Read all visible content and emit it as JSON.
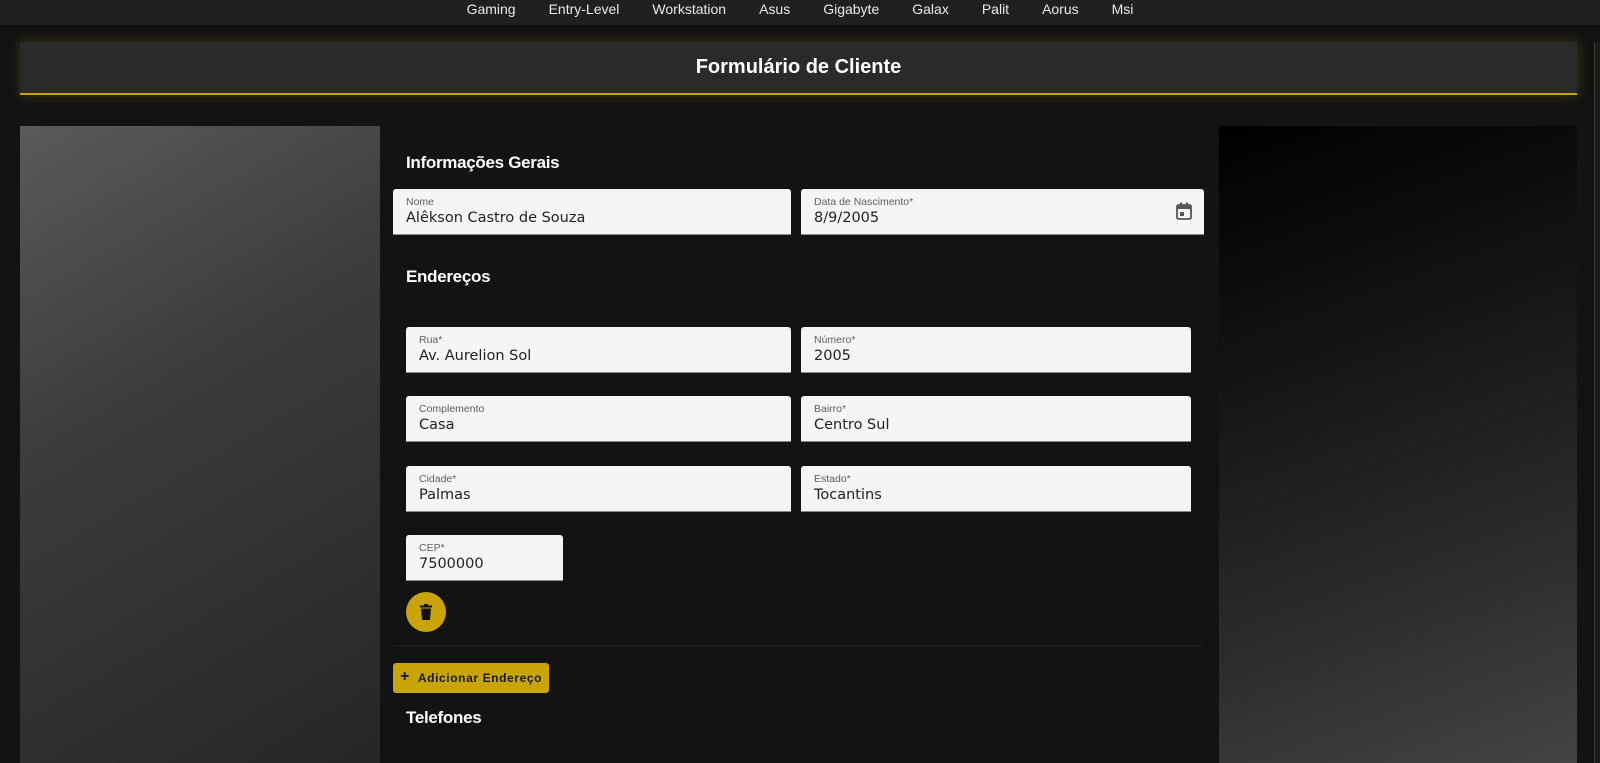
{
  "topnav": {
    "items": [
      "Gaming",
      "Entry-Level",
      "Workstation",
      "Asus",
      "Gigabyte",
      "Galax",
      "Palit",
      "Aorus",
      "Msi"
    ]
  },
  "header": {
    "title": "Formulário de Cliente"
  },
  "sections": {
    "general": "Informações Gerais",
    "addresses": "Endereços",
    "phones": "Telefones"
  },
  "general": {
    "name": {
      "label": "Nome",
      "value": "Alêkson Castro de Souza"
    },
    "birthdate": {
      "label": "Data de Nascimento*",
      "value": "8/9/2005",
      "icon": "calendar-icon"
    }
  },
  "address": {
    "street": {
      "label": "Rua*",
      "value": "Av. Aurelion Sol"
    },
    "number": {
      "label": "Número*",
      "value": "2005"
    },
    "complement": {
      "label": "Complemento",
      "value": "Casa"
    },
    "district": {
      "label": "Bairro*",
      "value": "Centro Sul"
    },
    "city": {
      "label": "Cidade*",
      "value": "Palmas"
    },
    "state": {
      "label": "Estado*",
      "value": "Tocantins"
    },
    "zip": {
      "label": "CEP*",
      "value": "7500000"
    },
    "delete_icon": "trash-icon"
  },
  "actions": {
    "add_address": "Adicionar Endereço",
    "add_icon": "plus-icon"
  },
  "colors": {
    "accent": "#c9a406",
    "background": "#131313",
    "field_bg": "#f5f5f5"
  }
}
